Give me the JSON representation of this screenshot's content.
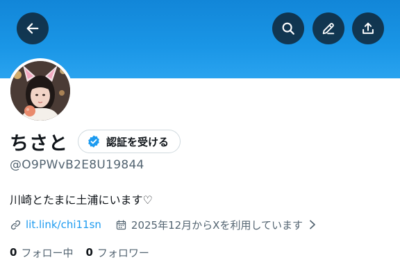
{
  "header": {
    "back_icon": "arrow-left-icon",
    "search_icon": "search-icon",
    "edit_icon": "pen-icon",
    "share_icon": "share-upload-icon",
    "banner_color": "#1d9bf0",
    "button_color": "#0f1419"
  },
  "profile": {
    "display_name": "ちさと",
    "verify_button_label": "認証を受ける",
    "verify_icon": "verified-badge-icon",
    "handle": "@O9PWvB2E8U19844",
    "bio": "川崎とたまに土浦にいます♡",
    "link_text": "lit.link/chi11sn",
    "link_icon": "link-icon",
    "joined_text": "2025年12月からXを利用しています",
    "joined_icon": "calendar-icon",
    "following_count": "0",
    "following_label": "フォロー中",
    "followers_count": "0",
    "followers_label": "フォロワー"
  },
  "colors": {
    "accent": "#1d9bf0",
    "text_primary": "#0f1419",
    "text_secondary": "#536471",
    "border": "#cfd9de"
  }
}
